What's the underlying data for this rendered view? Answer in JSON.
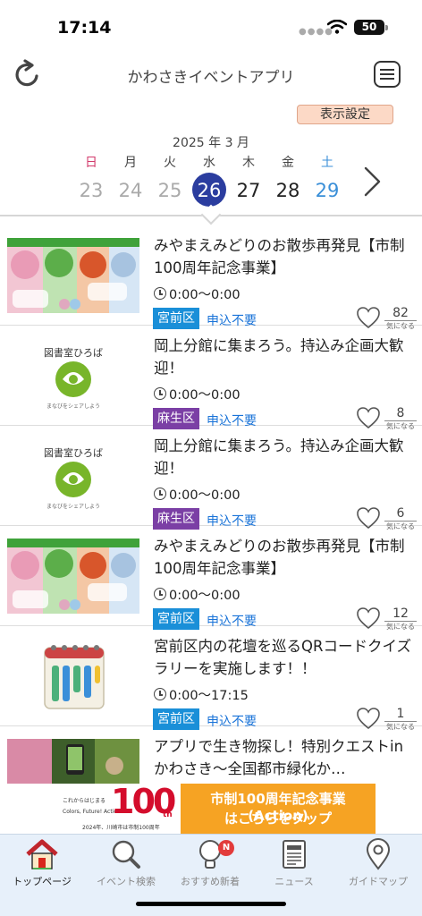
{
  "status_bar": {
    "time": "17:14",
    "battery": "50"
  },
  "header": {
    "title": "かわさきイベントアプリ"
  },
  "display_settings_label": "表示設定",
  "calendar": {
    "month_label": "2025 年 3 月",
    "days": [
      {
        "dow": "日",
        "num": "23"
      },
      {
        "dow": "月",
        "num": "24"
      },
      {
        "dow": "火",
        "num": "25"
      },
      {
        "dow": "水",
        "num": "26"
      },
      {
        "dow": "木",
        "num": "27"
      },
      {
        "dow": "金",
        "num": "28"
      },
      {
        "dow": "土",
        "num": "29"
      }
    ],
    "selected_index": 3
  },
  "events": [
    {
      "title": "みやまえみどりのお散歩再発見【市制100周年記念事業】",
      "time": "0:00〜0:00",
      "area": "宮前区",
      "area_color": "#1a8fd8",
      "apply": "申込不要",
      "likes": "82",
      "likes_label": "気になる",
      "thumb": "forest"
    },
    {
      "title": "岡上分館に集まろう。持込み企画大歓迎！",
      "time": "0:00〜0:00",
      "area": "麻生区",
      "area_color": "#7b3fa5",
      "apply": "申込不要",
      "likes": "8",
      "likes_label": "気になる",
      "thumb": "library",
      "thumb_text": "図書室ひろば",
      "thumb_sub": "まなびをシェアしよう"
    },
    {
      "title": "岡上分館に集まろう。持込み企画大歓迎！",
      "time": "0:00〜0:00",
      "area": "麻生区",
      "area_color": "#7b3fa5",
      "apply": "申込不要",
      "likes": "6",
      "likes_label": "気になる",
      "thumb": "library",
      "thumb_text": "図書室ひろば",
      "thumb_sub": "まなびをシェアしよう"
    },
    {
      "title": "みやまえみどりのお散歩再発見【市制100周年記念事業】",
      "time": "0:00〜0:00",
      "area": "宮前区",
      "area_color": "#1a8fd8",
      "apply": "申込不要",
      "likes": "12",
      "likes_label": "気になる",
      "thumb": "forest"
    },
    {
      "title": "宮前区内の花壇を巡るQRコードクイズラリーを実施します！！",
      "time": "0:00〜17:15",
      "area": "宮前区",
      "area_color": "#1a8fd8",
      "apply": "申込不要",
      "likes": "1",
      "likes_label": "気になる",
      "thumb": "calendar"
    },
    {
      "title": "アプリで生き物探し！特別クエストinかわさき〜全国都市緑化か…",
      "time": "",
      "area": "",
      "area_color": "#1a8fd8",
      "apply": "",
      "likes": "",
      "likes_label": "",
      "thumb": "photo"
    }
  ],
  "banner": {
    "left_line1": "これからはじまる",
    "left_line2": "Colors, Future! Actions",
    "left_line3": "2024年、川崎市は市制100周年",
    "big": "100",
    "big_suffix": "th",
    "right_line1": "市制100周年記念事業(Action)",
    "right_line2": "はこちらをタップ"
  },
  "nav": [
    {
      "label": "トップページ",
      "icon": "home-icon"
    },
    {
      "label": "イベント検索",
      "icon": "search-icon"
    },
    {
      "label": "おすすめ新着",
      "icon": "lightbulb-icon",
      "badge": "N"
    },
    {
      "label": "ニュース",
      "icon": "newspaper-icon"
    },
    {
      "label": "ガイドマップ",
      "icon": "map-pin-icon"
    }
  ],
  "colors": {
    "accent": "#2b3d9f",
    "sunday": "#d23a6b",
    "saturday": "#3a8fd8",
    "link": "#1973d8",
    "banner_orange": "#f6a323",
    "nav_bg": "#e7f0fa"
  }
}
